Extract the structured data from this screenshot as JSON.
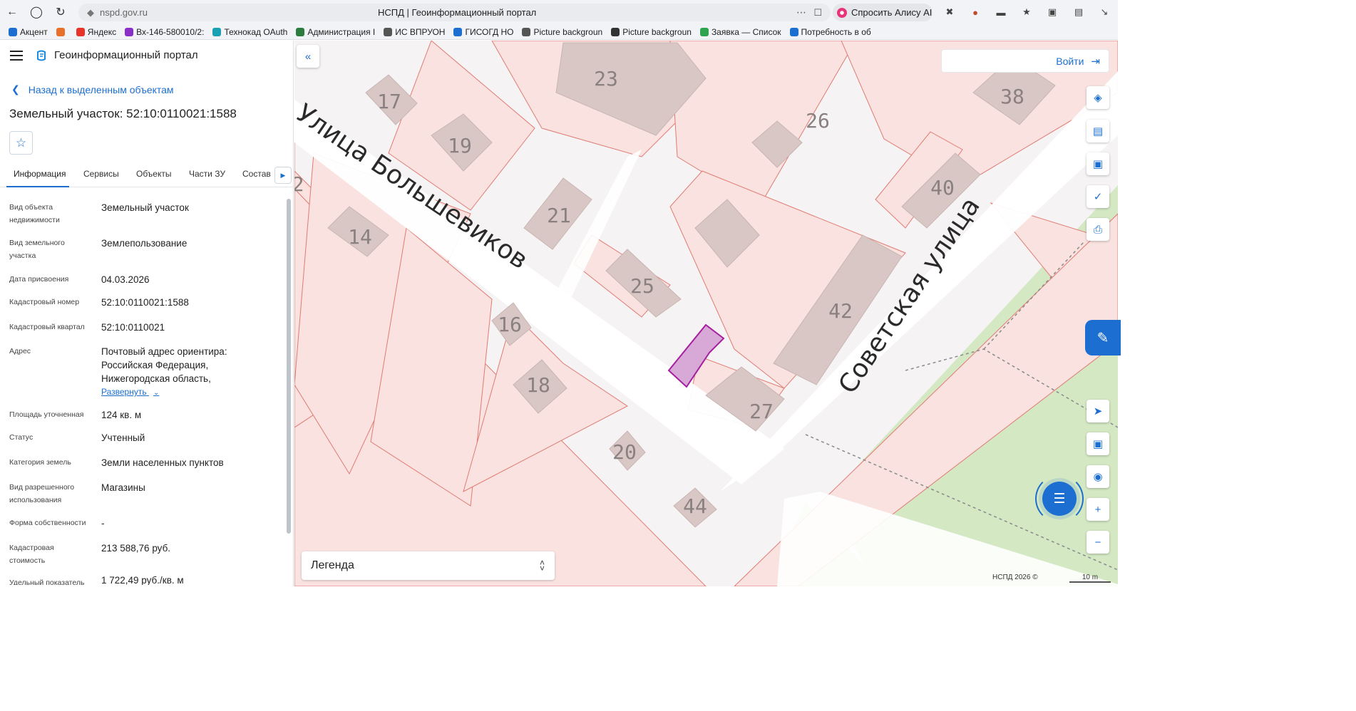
{
  "browser": {
    "url": "nspd.gov.ru",
    "page_title": "НСПД | Геоинформационный портал",
    "alice_label": "Спросить Алису AI"
  },
  "bookmarks": [
    {
      "label": "Акцент",
      "color": "#1c6fd1"
    },
    {
      "label": "",
      "color": "#e8702a"
    },
    {
      "label": "Яндекс",
      "color": "#e8332a"
    },
    {
      "label": "Вх-146-580010/2:",
      "color": "#8b2fc9"
    },
    {
      "label": "Технокад OAuth",
      "color": "#1aa0b3"
    },
    {
      "label": "Администрация I",
      "color": "#2a7d3c"
    },
    {
      "label": "ИС ВПРУОН",
      "color": "#555555"
    },
    {
      "label": "ГИСОГД НО",
      "color": "#1c6fd1"
    },
    {
      "label": "Picture backgroun",
      "color": "#555555"
    },
    {
      "label": "Picture backgroun",
      "color": "#333333"
    },
    {
      "label": "Заявка — Список",
      "color": "#2fa44f"
    },
    {
      "label": "Потребность в об",
      "color": "#1c6fd1"
    }
  ],
  "panel": {
    "app_title": "Геоинформационный портал",
    "back_link": "Назад к выделенным объектам",
    "object_title": "Земельный участок: 52:10:0110021:1588",
    "tabs": [
      "Информация",
      "Сервисы",
      "Объекты",
      "Части ЗУ",
      "Состав"
    ],
    "active_tab": "Информация",
    "fields": [
      {
        "label": "Вид объекта недвижимости",
        "value": "Земельный участок"
      },
      {
        "label": "Вид земельного участка",
        "value": "Землепользование"
      },
      {
        "label": "Дата присвоения",
        "value": "04.03.2026"
      },
      {
        "label": "Кадастровый номер",
        "value": "52:10:0110021:1588"
      },
      {
        "label": "Кадастровый квартал",
        "value": "52:10:0110021"
      },
      {
        "label": "Адрес",
        "value": "Почтовый адрес ориентира: Российская Федерация, Нижегородская область,"
      },
      {
        "label": "Площадь уточненная",
        "value": "124 кв. м"
      },
      {
        "label": "Статус",
        "value": "Учтенный"
      },
      {
        "label": "Категория земель",
        "value": "Земли населенных пунктов"
      },
      {
        "label": "Вид разрешенного использования",
        "value": "Магазины"
      },
      {
        "label": "Форма собственности",
        "value": "-"
      },
      {
        "label": "Кадастровая стоимость",
        "value": "213 588,76 руб."
      },
      {
        "label": "Удельный показатель",
        "value": "1 722,49 руб./кв. м"
      }
    ],
    "expand_link": "Развернуть"
  },
  "map": {
    "login_label": "Войти",
    "legend_label": "Легенда",
    "copyright": "НСПД 2026 ©",
    "scale_label": "10 m",
    "street_labels": [
      "Улица Большевиков",
      "Советская улица"
    ],
    "house_numbers": [
      "23",
      "17",
      "19",
      "26",
      "38",
      "40",
      "21",
      "14",
      "25",
      "42",
      "16",
      "18",
      "27",
      "20",
      "44",
      "2"
    ],
    "colors": {
      "parcel_stroke": "#e07b72",
      "parcel_fill": "#f9e2e0",
      "building": "#d9c7c5",
      "selected": "#a51fa0",
      "green": "#d4e8c4"
    }
  }
}
